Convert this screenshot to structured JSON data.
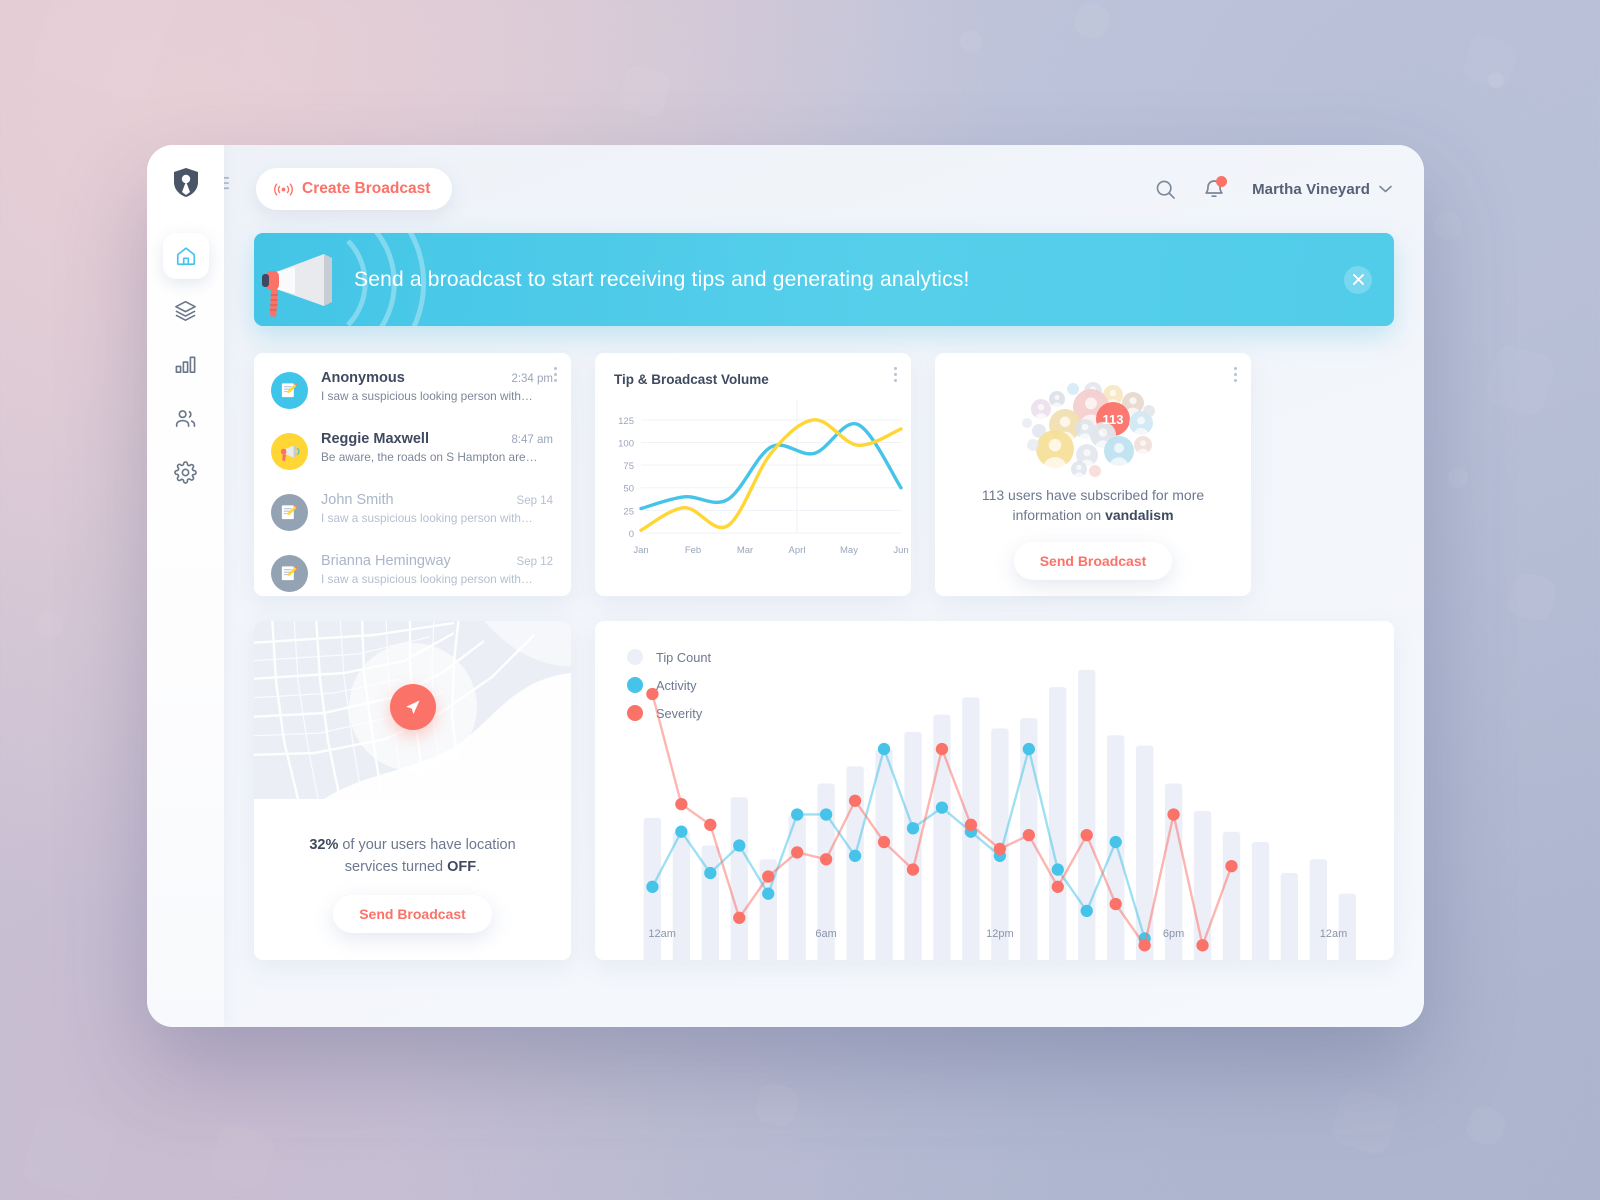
{
  "app": {
    "brand_icon": "shield-logo-icon",
    "menu_icon": "hamburger-icon"
  },
  "sidebar": {
    "items": [
      {
        "name": "home",
        "icon": "home-icon",
        "active": true
      },
      {
        "name": "layers",
        "icon": "layers-icon",
        "active": false
      },
      {
        "name": "analytics",
        "icon": "bar-chart-icon",
        "active": false
      },
      {
        "name": "users",
        "icon": "users-icon",
        "active": false
      },
      {
        "name": "settings",
        "icon": "gear-icon",
        "active": false
      }
    ]
  },
  "topbar": {
    "create_broadcast_label": "Create Broadcast",
    "create_broadcast_icon": "broadcast-signal-icon",
    "search_icon": "search-icon",
    "notification_icon": "bell-icon",
    "notification_dot": true,
    "user_name": "Martha Vineyard",
    "chevron_icon": "chevron-down-icon"
  },
  "banner": {
    "message": "Send a broadcast to start receiving tips and generating analytics!",
    "icon": "megaphone-icon",
    "close_icon": "close-icon",
    "color": "#51cce9"
  },
  "tips_card": {
    "menu_icon": "kebab-menu-icon",
    "items": [
      {
        "name": "Anonymous",
        "time": "2:34 pm",
        "message": "I saw a suspicious looking person with…",
        "avatar": "note-pencil-icon",
        "avatar_color": "#3fc4ea",
        "read": false
      },
      {
        "name": "Reggie Maxwell",
        "time": "8:47 am",
        "message": "Be aware, the roads on S Hampton are…",
        "avatar": "megaphone-icon",
        "avatar_color": "#ffd634",
        "read": false
      },
      {
        "name": "John Smith",
        "time": "Sep 14",
        "message": "I saw a suspicious looking person with…",
        "avatar": "note-pencil-icon",
        "avatar_color": "#93a3b3",
        "read": true
      },
      {
        "name": "Brianna Hemingway",
        "time": "Sep 12",
        "message": "I saw a suspicious looking person with…",
        "avatar": "note-pencil-icon",
        "avatar_color": "#93a3b3",
        "read": true
      }
    ]
  },
  "volume_card": {
    "title": "Tip & Broadcast Volume",
    "menu_icon": "kebab-menu-icon"
  },
  "subscribers_card": {
    "menu_icon": "kebab-menu-icon",
    "badge_count": "113",
    "text_prefix": "113 users have subscribed for more information on ",
    "text_highlight": "vandalism",
    "button_label": "Send Broadcast",
    "avatar_cluster_icon": "user-avatars-cluster-icon"
  },
  "map_card": {
    "pin_icon": "location-arrow-icon",
    "stat_percent": "32%",
    "text_middle": " of your users have location services turned ",
    "text_bold": "OFF",
    "text_end": ".",
    "button_label": "Send Broadcast"
  },
  "hours_card": {
    "legend": [
      {
        "label": "Tip Count",
        "color": "#eceff7"
      },
      {
        "label": "Activity",
        "color": "#45c3e8"
      },
      {
        "label": "Severity",
        "color": "#fb7268"
      }
    ]
  },
  "chart_data": [
    {
      "id": "tip-broadcast-volume",
      "type": "line",
      "title": "Tip & Broadcast Volume",
      "xlabel": "",
      "ylabel": "",
      "ylim": [
        0,
        137
      ],
      "yticks": [
        0,
        25,
        50,
        75,
        100,
        125
      ],
      "categories": [
        "Jan",
        "Feb",
        "Mar",
        "Aprl",
        "May",
        "Jun"
      ],
      "grid": true,
      "legend": "none",
      "series": [
        {
          "name": "Tips",
          "color": "#45c3e8",
          "values": [
            27,
            40,
            37,
            95,
            88,
            120,
            50
          ]
        },
        {
          "name": "Broadcasts",
          "color": "#ffd634",
          "values": [
            3,
            28,
            8,
            88,
            125,
            97,
            115
          ]
        }
      ]
    },
    {
      "id": "hourly-activity",
      "type": "bar+line",
      "title": "",
      "xlabel": "",
      "ylabel": "",
      "grid": false,
      "legend": "top-left",
      "categories": [
        "12am",
        "1am",
        "2am",
        "3am",
        "4am",
        "5am",
        "6am",
        "7am",
        "8am",
        "9am",
        "10am",
        "11am",
        "12pm",
        "1pm",
        "2pm",
        "3pm",
        "4pm",
        "5pm",
        "6pm",
        "7pm",
        "8pm",
        "9pm",
        "10pm",
        "11pm",
        "12am"
      ],
      "xticks": [
        "12am",
        "6am",
        "12pm",
        "6pm",
        "12am"
      ],
      "series": [
        {
          "name": "Tip Count",
          "type": "bar",
          "color": "#eceff7",
          "values": [
            42,
            38,
            34,
            48,
            30,
            43,
            52,
            57,
            62,
            67,
            72,
            77,
            68,
            71,
            80,
            85,
            66,
            63,
            52,
            44,
            38,
            35,
            26,
            30,
            20
          ]
        },
        {
          "name": "Activity",
          "type": "line",
          "color": "#45c3e8",
          "values": [
            22,
            38,
            26,
            34,
            20,
            43,
            43,
            31,
            62,
            39,
            45,
            38,
            31,
            62,
            27,
            15,
            35,
            7,
            0,
            0,
            0,
            0,
            0,
            0,
            0
          ]
        },
        {
          "name": "Severity",
          "type": "line",
          "color": "#fb7268",
          "values": [
            78,
            46,
            40,
            13,
            25,
            32,
            30,
            47,
            35,
            27,
            62,
            40,
            33,
            37,
            22,
            37,
            17,
            5,
            43,
            5,
            28,
            0,
            0,
            0,
            0
          ]
        }
      ]
    }
  ]
}
